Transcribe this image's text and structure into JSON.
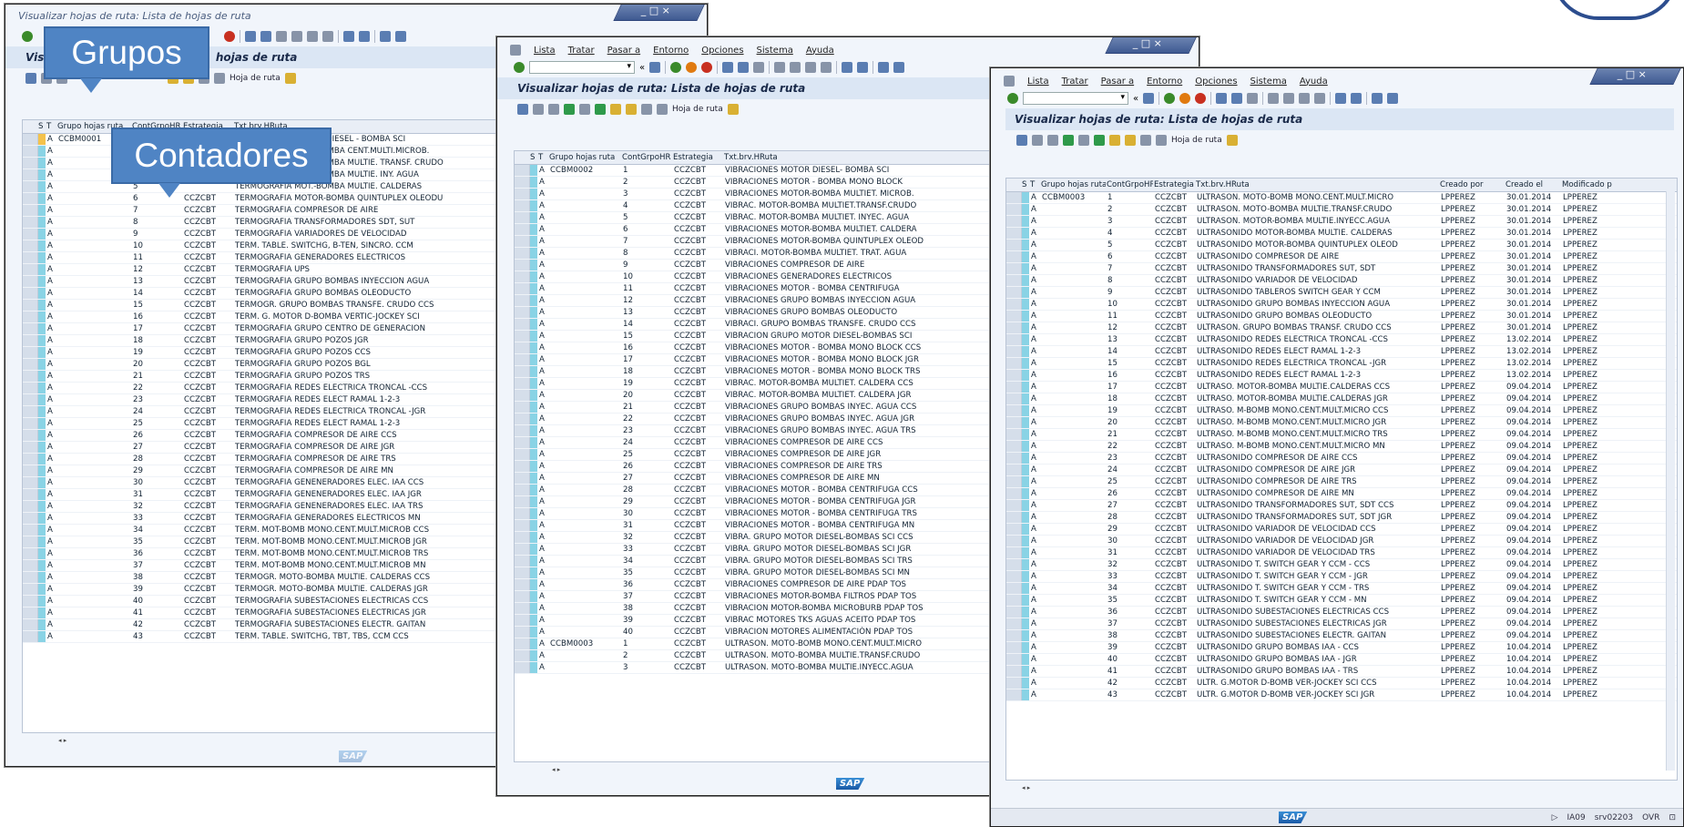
{
  "window1": {
    "title": "Visualizar hojas de ruta: Lista de hojas de ruta",
    "page_title_visible": "Visu",
    "page_title_tail": "hojas de ruta",
    "app_toolbar_label": "Hoja de ruta",
    "columns": [
      "",
      "S",
      "T",
      "Grupo hojas ruta",
      "ContGrpoHR",
      "Estrategia",
      "Txt.brv.HRuta"
    ],
    "rows": [
      [
        "A",
        "CCBM0001",
        "1",
        "CCZCBT",
        "TERMOGRAFIA MOTOR DIESEL - BOMBA SCI"
      ],
      [
        "A",
        "",
        "2",
        "",
        "TERMOGRAFIA MOT.-BOMBA CENT.MULTI.MICROB."
      ],
      [
        "A",
        "",
        "3",
        "",
        "TERMOGRAFIA MOT.-BOMBA MULTIE. TRANSF. CRUDO"
      ],
      [
        "A",
        "",
        "4",
        "",
        "TERMOGRAFIA MOT.-BOMBA MULTIE. INY. AGUA"
      ],
      [
        "A",
        "",
        "5",
        "",
        "TERMOGRAFIA MOT.-BOMBA MULTIE. CALDERAS"
      ],
      [
        "A",
        "",
        "6",
        "CCZCBT",
        "TERMOGRAFIA MOTOR-BOMBA QUINTUPLEX OLEODU"
      ],
      [
        "A",
        "",
        "7",
        "CCZCBT",
        "TERMOGRAFIA COMPRESOR DE AIRE"
      ],
      [
        "A",
        "",
        "8",
        "CCZCBT",
        "TERMOGRAFIA TRANSFORMADORES SDT, SUT"
      ],
      [
        "A",
        "",
        "9",
        "CCZCBT",
        "TERMOGRAFIA VARIADORES DE VELOCIDAD"
      ],
      [
        "A",
        "",
        "10",
        "CCZCBT",
        "TERM. TABLE. SWITCHG, B-TEN, SINCRO. CCM"
      ],
      [
        "A",
        "",
        "11",
        "CCZCBT",
        "TERMOGRAFIA GENERADORES ELECTRICOS"
      ],
      [
        "A",
        "",
        "12",
        "CCZCBT",
        "TERMOGRAFIA UPS"
      ],
      [
        "A",
        "",
        "13",
        "CCZCBT",
        "TERMOGRAFIA GRUPO BOMBAS INYECCION AGUA"
      ],
      [
        "A",
        "",
        "14",
        "CCZCBT",
        "TERMOGRAFIA GRUPO BOMBAS OLEODUCTO"
      ],
      [
        "A",
        "",
        "15",
        "CCZCBT",
        "TERMOGR. GRUPO BOMBAS TRANSFE. CRUDO CCS"
      ],
      [
        "A",
        "",
        "16",
        "CCZCBT",
        "TERM. G. MOTOR D-BOMBA VERTIC-JOCKEY SCI"
      ],
      [
        "A",
        "",
        "17",
        "CCZCBT",
        "TERMOGRAFIA GRUPO CENTRO DE GENERACION"
      ],
      [
        "A",
        "",
        "18",
        "CCZCBT",
        "TERMOGRAFIA GRUPO POZOS JGR"
      ],
      [
        "A",
        "",
        "19",
        "CCZCBT",
        "TERMOGRAFIA GRUPO POZOS CCS"
      ],
      [
        "A",
        "",
        "20",
        "CCZCBT",
        "TERMOGRAFIA GRUPO POZOS BGL"
      ],
      [
        "A",
        "",
        "21",
        "CCZCBT",
        "TERMOGRAFIA GRUPO POZOS TRS"
      ],
      [
        "A",
        "",
        "22",
        "CCZCBT",
        "TERMOGRAFIA REDES ELECTRICA TRONCAL -CCS"
      ],
      [
        "A",
        "",
        "23",
        "CCZCBT",
        "TERMOGRAFIA REDES ELECT RAMAL 1-2-3"
      ],
      [
        "A",
        "",
        "24",
        "CCZCBT",
        "TERMOGRAFIA REDES ELECTRICA TRONCAL -JGR"
      ],
      [
        "A",
        "",
        "25",
        "CCZCBT",
        "TERMOGRAFIA REDES ELECT RAMAL 1-2-3"
      ],
      [
        "A",
        "",
        "26",
        "CCZCBT",
        "TERMOGRAFIA COMPRESOR DE AIRE CCS"
      ],
      [
        "A",
        "",
        "27",
        "CCZCBT",
        "TERMOGRAFIA COMPRESOR DE AIRE JGR"
      ],
      [
        "A",
        "",
        "28",
        "CCZCBT",
        "TERMOGRAFIA COMPRESOR DE AIRE TRS"
      ],
      [
        "A",
        "",
        "29",
        "CCZCBT",
        "TERMOGRAFIA COMPRESOR DE AIRE MN"
      ],
      [
        "A",
        "",
        "30",
        "CCZCBT",
        "TERMOGRAFIA GENENERADORES ELEC. IAA CCS"
      ],
      [
        "A",
        "",
        "31",
        "CCZCBT",
        "TERMOGRAFIA GENENERADORES ELEC. IAA JGR"
      ],
      [
        "A",
        "",
        "32",
        "CCZCBT",
        "TERMOGRAFIA GENENERADORES ELEC. IAA TRS"
      ],
      [
        "A",
        "",
        "33",
        "CCZCBT",
        "TERMOGRAFIA GENERADORES ELECTRICOS MN"
      ],
      [
        "A",
        "",
        "34",
        "CCZCBT",
        "TERM. MOT-BOMB MONO.CENT.MULT.MICROB CCS"
      ],
      [
        "A",
        "",
        "35",
        "CCZCBT",
        "TERM. MOT-BOMB MONO.CENT.MULT.MICROB JGR"
      ],
      [
        "A",
        "",
        "36",
        "CCZCBT",
        "TERM. MOT-BOMB MONO.CENT.MULT.MICROB TRS"
      ],
      [
        "A",
        "",
        "37",
        "CCZCBT",
        "TERM. MOT-BOMB MONO.CENT.MULT.MICROB MN"
      ],
      [
        "A",
        "",
        "38",
        "CCZCBT",
        "TERMOGR. MOTO-BOMBA MULTIE. CALDERAS CCS"
      ],
      [
        "A",
        "",
        "39",
        "CCZCBT",
        "TERMOGR. MOTO-BOMBA MULTIE. CALDERAS JGR"
      ],
      [
        "A",
        "",
        "40",
        "CCZCBT",
        "TERMOGRAFIA SUBESTACIONES ELECTRICAS CCS"
      ],
      [
        "A",
        "",
        "41",
        "CCZCBT",
        "TERMOGRAFIA SUBESTACIONES ELECTRICAS JGR"
      ],
      [
        "A",
        "",
        "42",
        "CCZCBT",
        "TERMOGRAFIA SUBESTACIONES ELECTR. GAITAN"
      ],
      [
        "A",
        "",
        "43",
        "CCZCBT",
        "TERM. TABLE. SWITCHG, TBT, TBS, CCM CCS"
      ]
    ]
  },
  "window2": {
    "menu": [
      "Lista",
      "Tratar",
      "Pasar a",
      "Entorno",
      "Opciones",
      "Sistema",
      "Ayuda"
    ],
    "title": "Visualizar hojas de ruta: Lista de hojas de ruta",
    "app_toolbar_label": "Hoja de ruta",
    "columns": [
      "",
      "S",
      "T",
      "Grupo hojas ruta",
      "ContGrpoHR",
      "Estrategia",
      "Txt.brv.HRuta"
    ],
    "sap_logo": "SAP",
    "rows": [
      [
        "A",
        "CCBM0002",
        "1",
        "CCZCBT",
        "VIBRACIONES MOTOR DIESEL- BOMBA SCI"
      ],
      [
        "A",
        "",
        "2",
        "CCZCBT",
        "VIBRACIONES MOTOR - BOMBA MONO BLOCK"
      ],
      [
        "A",
        "",
        "3",
        "CCZCBT",
        "VIBRACIONES MOTOR-BOMBA MULTIET. MICROB."
      ],
      [
        "A",
        "",
        "4",
        "CCZCBT",
        "VIBRAC. MOTOR-BOMBA MULTIET.TRANSF.CRUDO"
      ],
      [
        "A",
        "",
        "5",
        "CCZCBT",
        "VIBRAC. MOTOR-BOMBA MULTIET. INYEC. AGUA"
      ],
      [
        "A",
        "",
        "6",
        "CCZCBT",
        "VIBRACIONES MOTOR-BOMBA MULTIET. CALDERA"
      ],
      [
        "A",
        "",
        "7",
        "CCZCBT",
        "VIBRACIONES MOTOR-BOMBA QUINTUPLEX OLEOD"
      ],
      [
        "A",
        "",
        "8",
        "CCZCBT",
        "VIBRACI. MOTOR-BOMBA MULTIET. TRAT. AGUA"
      ],
      [
        "A",
        "",
        "9",
        "CCZCBT",
        "VIBRACIONES COMPRESOR DE AIRE"
      ],
      [
        "A",
        "",
        "10",
        "CCZCBT",
        "VIBRACIONES GENERADORES ELECTRICOS"
      ],
      [
        "A",
        "",
        "11",
        "CCZCBT",
        "VIBRACIONES MOTOR - BOMBA CENTRIFUGA"
      ],
      [
        "A",
        "",
        "12",
        "CCZCBT",
        "VIBRACIONES GRUPO BOMBAS INYECCION AGUA"
      ],
      [
        "A",
        "",
        "13",
        "CCZCBT",
        "VIBRACIONES GRUPO BOMBAS OLEODUCTO"
      ],
      [
        "A",
        "",
        "14",
        "CCZCBT",
        "VIBRACI. GRUPO BOMBAS TRANSFE. CRUDO CCS"
      ],
      [
        "A",
        "",
        "15",
        "CCZCBT",
        "VIBRACION GRUPO MOTOR DIESEL-BOMBAS SCI"
      ],
      [
        "A",
        "",
        "16",
        "CCZCBT",
        "VIBRACIONES MOTOR - BOMBA MONO BLOCK CCS"
      ],
      [
        "A",
        "",
        "17",
        "CCZCBT",
        "VIBRACIONES MOTOR - BOMBA MONO BLOCK JGR"
      ],
      [
        "A",
        "",
        "18",
        "CCZCBT",
        "VIBRACIONES MOTOR - BOMBA MONO BLOCK TRS"
      ],
      [
        "A",
        "",
        "19",
        "CCZCBT",
        "VIBRAC. MOTOR-BOMBA MULTIET. CALDERA CCS"
      ],
      [
        "A",
        "",
        "20",
        "CCZCBT",
        "VIBRAC. MOTOR-BOMBA MULTIET. CALDERA JGR"
      ],
      [
        "A",
        "",
        "21",
        "CCZCBT",
        "VIBRACIONES GRUPO BOMBAS INYEC. AGUA CCS"
      ],
      [
        "A",
        "",
        "22",
        "CCZCBT",
        "VIBRACIONES GRUPO BOMBAS INYEC. AGUA JGR"
      ],
      [
        "A",
        "",
        "23",
        "CCZCBT",
        "VIBRACIONES GRUPO BOMBAS INYEC. AGUA TRS"
      ],
      [
        "A",
        "",
        "24",
        "CCZCBT",
        "VIBRACIONES COMPRESOR DE AIRE  CCS"
      ],
      [
        "A",
        "",
        "25",
        "CCZCBT",
        "VIBRACIONES COMPRESOR DE AIRE  JGR"
      ],
      [
        "A",
        "",
        "26",
        "CCZCBT",
        "VIBRACIONES COMPRESOR DE AIRE  TRS"
      ],
      [
        "A",
        "",
        "27",
        "CCZCBT",
        "VIBRACIONES COMPRESOR DE AIRE  MN"
      ],
      [
        "A",
        "",
        "28",
        "CCZCBT",
        "VIBRACIONES MOTOR - BOMBA CENTRIFUGA CCS"
      ],
      [
        "A",
        "",
        "29",
        "CCZCBT",
        "VIBRACIONES MOTOR - BOMBA CENTRIFUGA JGR"
      ],
      [
        "A",
        "",
        "30",
        "CCZCBT",
        "VIBRACIONES MOTOR - BOMBA CENTRIFUGA TRS"
      ],
      [
        "A",
        "",
        "31",
        "CCZCBT",
        "VIBRACIONES MOTOR - BOMBA CENTRIFUGA MN"
      ],
      [
        "A",
        "",
        "32",
        "CCZCBT",
        "VIBRA. GRUPO MOTOR DIESEL-BOMBAS SCI CCS"
      ],
      [
        "A",
        "",
        "33",
        "CCZCBT",
        "VIBRA. GRUPO MOTOR DIESEL-BOMBAS SCI JGR"
      ],
      [
        "A",
        "",
        "34",
        "CCZCBT",
        "VIBRA. GRUPO MOTOR DIESEL-BOMBAS SCI TRS"
      ],
      [
        "A",
        "",
        "35",
        "CCZCBT",
        "VIBRA. GRUPO MOTOR DIESEL-BOMBAS SCI MN"
      ],
      [
        "A",
        "",
        "36",
        "CCZCBT",
        "VIBRACIONES COMPRESOR DE AIRE  PDAP TOS"
      ],
      [
        "A",
        "",
        "37",
        "CCZCBT",
        "VIBRACIONES MOTOR-BOMBA FILTROS PDAP TOS"
      ],
      [
        "A",
        "",
        "38",
        "CCZCBT",
        "VIBRACION MOTOR-BOMBA MICROBURB PDAP TOS"
      ],
      [
        "A",
        "",
        "39",
        "CCZCBT",
        "VIBRAC MOTORES TKS AGUAS ACEITO PDAP TOS"
      ],
      [
        "A",
        "",
        "40",
        "CCZCBT",
        "VIBRACION MOTORES ALIMENTACIÓN PDAP TOS"
      ],
      [
        "A",
        "CCBM0003",
        "1",
        "CCZCBT",
        "ULTRASON. MOTO-BOMB MONO.CENT.MULT.MICRO"
      ],
      [
        "A",
        "",
        "2",
        "CCZCBT",
        "ULTRASON. MOTO-BOMBA MULTIE.TRANSF.CRUDO"
      ],
      [
        "A",
        "",
        "3",
        "CCZCBT",
        "ULTRASON. MOTO-BOMBA MULTIE.INYECC.AGUA"
      ]
    ]
  },
  "window3": {
    "menu": [
      "Lista",
      "Tratar",
      "Pasar a",
      "Entorno",
      "Opciones",
      "Sistema",
      "Ayuda"
    ],
    "title": "Visualizar hojas de ruta: Lista de hojas de ruta",
    "app_toolbar_label": "Hoja de ruta",
    "columns": [
      "",
      "S",
      "T",
      "Grupo hojas ruta",
      "ContGrpoHR",
      "Estrategia",
      "Txt.brv.HRuta",
      "Creado por",
      "Creado el",
      "Modificado p"
    ],
    "sap_logo": "SAP",
    "status": {
      "system": "IA09",
      "server": "srv02203",
      "mode": "OVR"
    },
    "rows": [
      [
        "A",
        "CCBM0003",
        "1",
        "CCZCBT",
        "ULTRASON. MOTO-BOMB MONO.CENT.MULT.MICRO",
        "LPPEREZ",
        "30.01.2014",
        "LPPEREZ"
      ],
      [
        "A",
        "",
        "2",
        "CCZCBT",
        "ULTRASON. MOTO-BOMBA MULTIE.TRANSF.CRUDO",
        "LPPEREZ",
        "30.01.2014",
        "LPPEREZ"
      ],
      [
        "A",
        "",
        "3",
        "CCZCBT",
        "ULTRASON. MOTOR-BOMBA MULTIE.INYECC.AGUA",
        "LPPEREZ",
        "30.01.2014",
        "LPPEREZ"
      ],
      [
        "A",
        "",
        "4",
        "CCZCBT",
        "ULTRASONIDO MOTOR-BOMBA MULTIE. CALDERAS",
        "LPPEREZ",
        "30.01.2014",
        "LPPEREZ"
      ],
      [
        "A",
        "",
        "5",
        "CCZCBT",
        "ULTRASONIDO MOTOR-BOMBA QUINTUPLEX OLEOD",
        "LPPEREZ",
        "30.01.2014",
        "LPPEREZ"
      ],
      [
        "A",
        "",
        "6",
        "CCZCBT",
        "ULTRASONIDO COMPRESOR DE AIRE",
        "LPPEREZ",
        "30.01.2014",
        "LPPEREZ"
      ],
      [
        "A",
        "",
        "7",
        "CCZCBT",
        "ULTRASONIDO TRANSFORMADORES SUT, SDT",
        "LPPEREZ",
        "30.01.2014",
        "LPPEREZ"
      ],
      [
        "A",
        "",
        "8",
        "CCZCBT",
        "ULTRASONIDO VARIADOR DE VELOCIDAD",
        "LPPEREZ",
        "30.01.2014",
        "LPPEREZ"
      ],
      [
        "A",
        "",
        "9",
        "CCZCBT",
        "ULTRASONIDO TABLEROS SWITCH GEAR Y CCM",
        "LPPEREZ",
        "30.01.2014",
        "LPPEREZ"
      ],
      [
        "A",
        "",
        "10",
        "CCZCBT",
        "ULTRASONIDO GRUPO BOMBAS INYECCION AGUA",
        "LPPEREZ",
        "30.01.2014",
        "LPPEREZ"
      ],
      [
        "A",
        "",
        "11",
        "CCZCBT",
        "ULTRASONIDO GRUPO BOMBAS OLEODUCTO",
        "LPPEREZ",
        "30.01.2014",
        "LPPEREZ"
      ],
      [
        "A",
        "",
        "12",
        "CCZCBT",
        "ULTRASON. GRUPO BOMBAS TRANSF. CRUDO CCS",
        "LPPEREZ",
        "30.01.2014",
        "LPPEREZ"
      ],
      [
        "A",
        "",
        "13",
        "CCZCBT",
        "ULTRASONIDO REDES ELECTRICA TRONCAL -CCS",
        "LPPEREZ",
        "13.02.2014",
        "LPPEREZ"
      ],
      [
        "A",
        "",
        "14",
        "CCZCBT",
        "ULTRASONIDO REDES ELECT RAMAL 1-2-3",
        "LPPEREZ",
        "13.02.2014",
        "LPPEREZ"
      ],
      [
        "A",
        "",
        "15",
        "CCZCBT",
        "ULTRASONIDO REDES ELECTRICA TRONCAL -JGR",
        "LPPEREZ",
        "13.02.2014",
        "LPPEREZ"
      ],
      [
        "A",
        "",
        "16",
        "CCZCBT",
        "ULTRASONIDO REDES ELECT RAMAL 1-2-3",
        "LPPEREZ",
        "13.02.2014",
        "LPPEREZ"
      ],
      [
        "A",
        "",
        "17",
        "CCZCBT",
        "ULTRASO. MOTOR-BOMBA MULTIE.CALDERAS CCS",
        "LPPEREZ",
        "09.04.2014",
        "LPPEREZ"
      ],
      [
        "A",
        "",
        "18",
        "CCZCBT",
        "ULTRASO. MOTOR-BOMBA MULTIE.CALDERAS JGR",
        "LPPEREZ",
        "09.04.2014",
        "LPPEREZ"
      ],
      [
        "A",
        "",
        "19",
        "CCZCBT",
        "ULTRASO. M-BOMB MONO.CENT.MULT.MICRO CCS",
        "LPPEREZ",
        "09.04.2014",
        "LPPEREZ"
      ],
      [
        "A",
        "",
        "20",
        "CCZCBT",
        "ULTRASO. M-BOMB MONO.CENT.MULT.MICRO JGR",
        "LPPEREZ",
        "09.04.2014",
        "LPPEREZ"
      ],
      [
        "A",
        "",
        "21",
        "CCZCBT",
        "ULTRASO. M-BOMB MONO.CENT.MULT.MICRO TRS",
        "LPPEREZ",
        "09.04.2014",
        "LPPEREZ"
      ],
      [
        "A",
        "",
        "22",
        "CCZCBT",
        "ULTRASO. M-BOMB MONO.CENT.MULT.MICRO MN",
        "LPPEREZ",
        "09.04.2014",
        "LPPEREZ"
      ],
      [
        "A",
        "",
        "23",
        "CCZCBT",
        "ULTRASONIDO COMPRESOR DE AIRE CCS",
        "LPPEREZ",
        "09.04.2014",
        "LPPEREZ"
      ],
      [
        "A",
        "",
        "24",
        "CCZCBT",
        "ULTRASONIDO COMPRESOR DE AIRE JGR",
        "LPPEREZ",
        "09.04.2014",
        "LPPEREZ"
      ],
      [
        "A",
        "",
        "25",
        "CCZCBT",
        "ULTRASONIDO COMPRESOR DE AIRE TRS",
        "LPPEREZ",
        "09.04.2014",
        "LPPEREZ"
      ],
      [
        "A",
        "",
        "26",
        "CCZCBT",
        "ULTRASONIDO COMPRESOR DE AIRE MN",
        "LPPEREZ",
        "09.04.2014",
        "LPPEREZ"
      ],
      [
        "A",
        "",
        "27",
        "CCZCBT",
        "ULTRASONIDO TRANSFORMADORES SUT, SDT CCS",
        "LPPEREZ",
        "09.04.2014",
        "LPPEREZ"
      ],
      [
        "A",
        "",
        "28",
        "CCZCBT",
        "ULTRASONIDO TRANSFORMADORES SUT, SDT JGR",
        "LPPEREZ",
        "09.04.2014",
        "LPPEREZ"
      ],
      [
        "A",
        "",
        "29",
        "CCZCBT",
        "ULTRASONIDO VARIADOR DE VELOCIDAD CCS",
        "LPPEREZ",
        "09.04.2014",
        "LPPEREZ"
      ],
      [
        "A",
        "",
        "30",
        "CCZCBT",
        "ULTRASONIDO VARIADOR DE VELOCIDAD JGR",
        "LPPEREZ",
        "09.04.2014",
        "LPPEREZ"
      ],
      [
        "A",
        "",
        "31",
        "CCZCBT",
        "ULTRASONIDO VARIADOR DE VELOCIDAD TRS",
        "LPPEREZ",
        "09.04.2014",
        "LPPEREZ"
      ],
      [
        "A",
        "",
        "32",
        "CCZCBT",
        "ULTRASONIDO T. SWITCH GEAR Y CCM - CCS",
        "LPPEREZ",
        "09.04.2014",
        "LPPEREZ"
      ],
      [
        "A",
        "",
        "33",
        "CCZCBT",
        "ULTRASONIDO T. SWITCH GEAR Y CCM - JGR",
        "LPPEREZ",
        "09.04.2014",
        "LPPEREZ"
      ],
      [
        "A",
        "",
        "34",
        "CCZCBT",
        "ULTRASONIDO T. SWITCH GEAR Y CCM - TRS",
        "LPPEREZ",
        "09.04.2014",
        "LPPEREZ"
      ],
      [
        "A",
        "",
        "35",
        "CCZCBT",
        "ULTRASONIDO T. SWITCH GEAR Y CCM - MN",
        "LPPEREZ",
        "09.04.2014",
        "LPPEREZ"
      ],
      [
        "A",
        "",
        "36",
        "CCZCBT",
        "ULTRASONIDO SUBESTACIONES ELECTRICAS CCS",
        "LPPEREZ",
        "09.04.2014",
        "LPPEREZ"
      ],
      [
        "A",
        "",
        "37",
        "CCZCBT",
        "ULTRASONIDO SUBESTACIONES ELECTRICAS JGR",
        "LPPEREZ",
        "09.04.2014",
        "LPPEREZ"
      ],
      [
        "A",
        "",
        "38",
        "CCZCBT",
        "ULTRASONIDO SUBESTACIONES ELECTR. GAITAN",
        "LPPEREZ",
        "09.04.2014",
        "LPPEREZ"
      ],
      [
        "A",
        "",
        "39",
        "CCZCBT",
        "ULTRASONIDO GRUPO BOMBAS IAA - CCS",
        "LPPEREZ",
        "10.04.2014",
        "LPPEREZ"
      ],
      [
        "A",
        "",
        "40",
        "CCZCBT",
        "ULTRASONIDO GRUPO BOMBAS IAA - JGR",
        "LPPEREZ",
        "10.04.2014",
        "LPPEREZ"
      ],
      [
        "A",
        "",
        "41",
        "CCZCBT",
        "ULTRASONIDO GRUPO BOMBAS IAA - TRS",
        "LPPEREZ",
        "10.04.2014",
        "LPPEREZ"
      ],
      [
        "A",
        "",
        "42",
        "CCZCBT",
        "ULTR. G.MOTOR D-BOMB VER-JOCKEY SCI  CCS",
        "LPPEREZ",
        "10.04.2014",
        "LPPEREZ"
      ],
      [
        "A",
        "",
        "43",
        "CCZCBT",
        "ULTR. G.MOTOR D-BOMB VER-JOCKEY SCI  JGR",
        "LPPEREZ",
        "10.04.2014",
        "LPPEREZ"
      ]
    ]
  },
  "callouts": {
    "grupos": "Grupos",
    "contadores": "Contadores"
  },
  "colors": {
    "status_cell": "#89d3e5",
    "callout": "#4f84c4",
    "title_blue": "#4a5d7e"
  }
}
